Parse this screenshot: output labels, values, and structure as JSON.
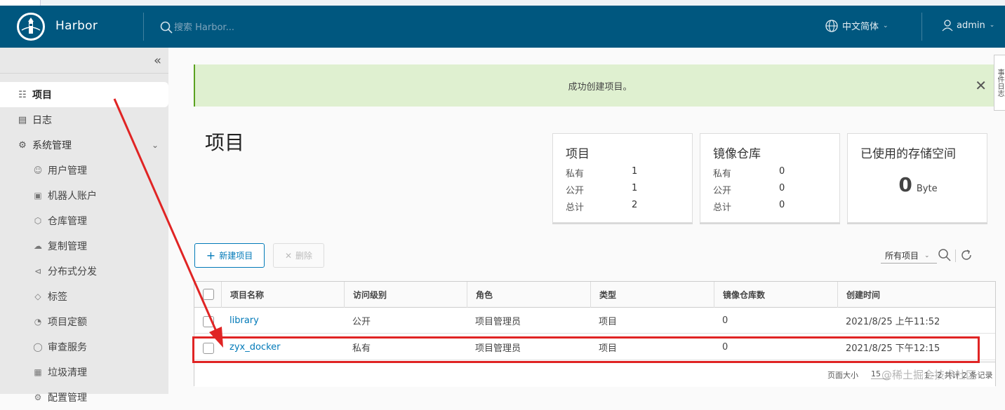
{
  "header": {
    "brand": "Harbor",
    "search_placeholder": "搜索 Harbor...",
    "language": "中文简体",
    "user": "admin"
  },
  "sidebar": {
    "items": [
      {
        "label": "项目",
        "icon": "project-icon"
      },
      {
        "label": "日志",
        "icon": "log-icon"
      },
      {
        "label": "系统管理",
        "icon": "admin-icon"
      }
    ],
    "subitems": [
      {
        "label": "用户管理",
        "icon": "users-icon"
      },
      {
        "label": "机器人账户",
        "icon": "robot-icon"
      },
      {
        "label": "仓库管理",
        "icon": "registry-icon"
      },
      {
        "label": "复制管理",
        "icon": "replication-icon"
      },
      {
        "label": "分布式分发",
        "icon": "distribution-icon"
      },
      {
        "label": "标签",
        "icon": "tag-icon"
      },
      {
        "label": "项目定额",
        "icon": "quota-icon"
      },
      {
        "label": "审查服务",
        "icon": "shield-icon"
      },
      {
        "label": "垃圾清理",
        "icon": "trash-icon"
      },
      {
        "label": "配置管理",
        "icon": "config-icon"
      }
    ]
  },
  "alert": {
    "message": "成功创建项目。"
  },
  "side_tab": "事件日志",
  "page": {
    "title": "项目"
  },
  "cards": {
    "projects": {
      "title": "项目",
      "rows": [
        {
          "label": "私有",
          "value": "1"
        },
        {
          "label": "公开",
          "value": "1"
        },
        {
          "label": "总计",
          "value": "2"
        }
      ]
    },
    "repos": {
      "title": "镜像仓库",
      "rows": [
        {
          "label": "私有",
          "value": "0"
        },
        {
          "label": "公开",
          "value": "0"
        },
        {
          "label": "总计",
          "value": "0"
        }
      ]
    },
    "storage": {
      "title": "已使用的存储空间",
      "value": "0",
      "unit": "Byte"
    }
  },
  "toolbar": {
    "new_label": "新建项目",
    "delete_label": "删除",
    "filter": "所有项目"
  },
  "table": {
    "headers": [
      "项目名称",
      "访问级别",
      "角色",
      "类型",
      "镜像仓库数",
      "创建时间"
    ],
    "rows": [
      {
        "name": "library",
        "access": "公开",
        "role": "项目管理员",
        "type": "项目",
        "repos": "0",
        "created": "2021/8/25 上午11:52"
      },
      {
        "name": "zyx_docker",
        "access": "私有",
        "role": "项目管理员",
        "type": "项目",
        "repos": "0",
        "created": "2021/8/25 下午12:15"
      }
    ],
    "footer": {
      "page_size_label": "页面大小",
      "page_size": "15",
      "total": "1 - 2 共计 2 条记录"
    }
  },
  "watermark": "@稀土掘金技术社区",
  "colors": {
    "header_bg": "#00577f",
    "accent": "#0079b8",
    "annotation": "#e02424",
    "alert_bg": "#dff0d0"
  }
}
